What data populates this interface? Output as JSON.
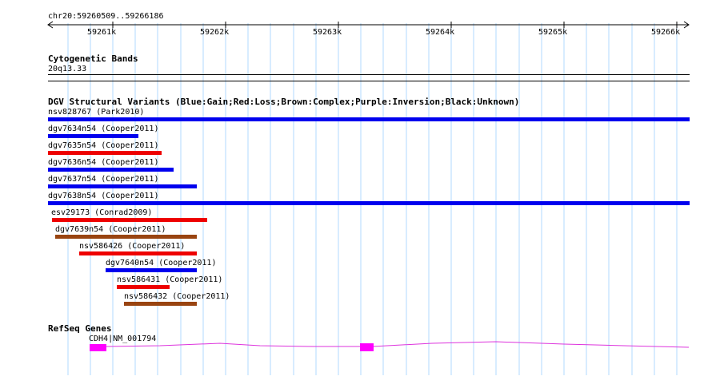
{
  "ruler": {
    "coordinate_label": "chr20:59260509..59266186",
    "tick_labels": [
      "59261k",
      "59262k",
      "59263k",
      "59264k",
      "59265k",
      "59266k"
    ]
  },
  "cytoband": {
    "title": "Cytogenetic Bands",
    "band_label": "20q13.33"
  },
  "dgv": {
    "title": "DGV Structural Variants (Blue:Gain;Red:Loss;Brown:Complex;Purple:Inversion;Black:Unknown)",
    "colors": {
      "gain": "#0000ee",
      "loss": "#ee0000",
      "complex": "#994411"
    },
    "variants": [
      {
        "label": "nsv828767 (Park2010)",
        "type": "gain"
      },
      {
        "label": "dgv7634n54 (Cooper2011)",
        "type": "gain"
      },
      {
        "label": "dgv7635n54 (Cooper2011)",
        "type": "loss"
      },
      {
        "label": "dgv7636n54 (Cooper2011)",
        "type": "gain"
      },
      {
        "label": "dgv7637n54 (Cooper2011)",
        "type": "gain"
      },
      {
        "label": "dgv7638n54 (Cooper2011)",
        "type": "gain"
      },
      {
        "label": "esv29173 (Conrad2009)",
        "type": "loss"
      },
      {
        "label": "dgv7639n54 (Cooper2011)",
        "type": "complex"
      },
      {
        "label": "nsv586426 (Cooper2011)",
        "type": "loss"
      },
      {
        "label": "dgv7640n54 (Cooper2011)",
        "type": "gain"
      },
      {
        "label": "nsv586431 (Cooper2011)",
        "type": "loss"
      },
      {
        "label": "nsv586432 (Cooper2011)",
        "type": "complex"
      }
    ]
  },
  "refseq": {
    "title": "RefSeq Genes",
    "gene_label": "CDH4|NM_001794",
    "colors": {
      "exon": "#ff00ff",
      "intron": "#dd33dd"
    }
  },
  "colors": {
    "grid": "#b0d8ff"
  }
}
